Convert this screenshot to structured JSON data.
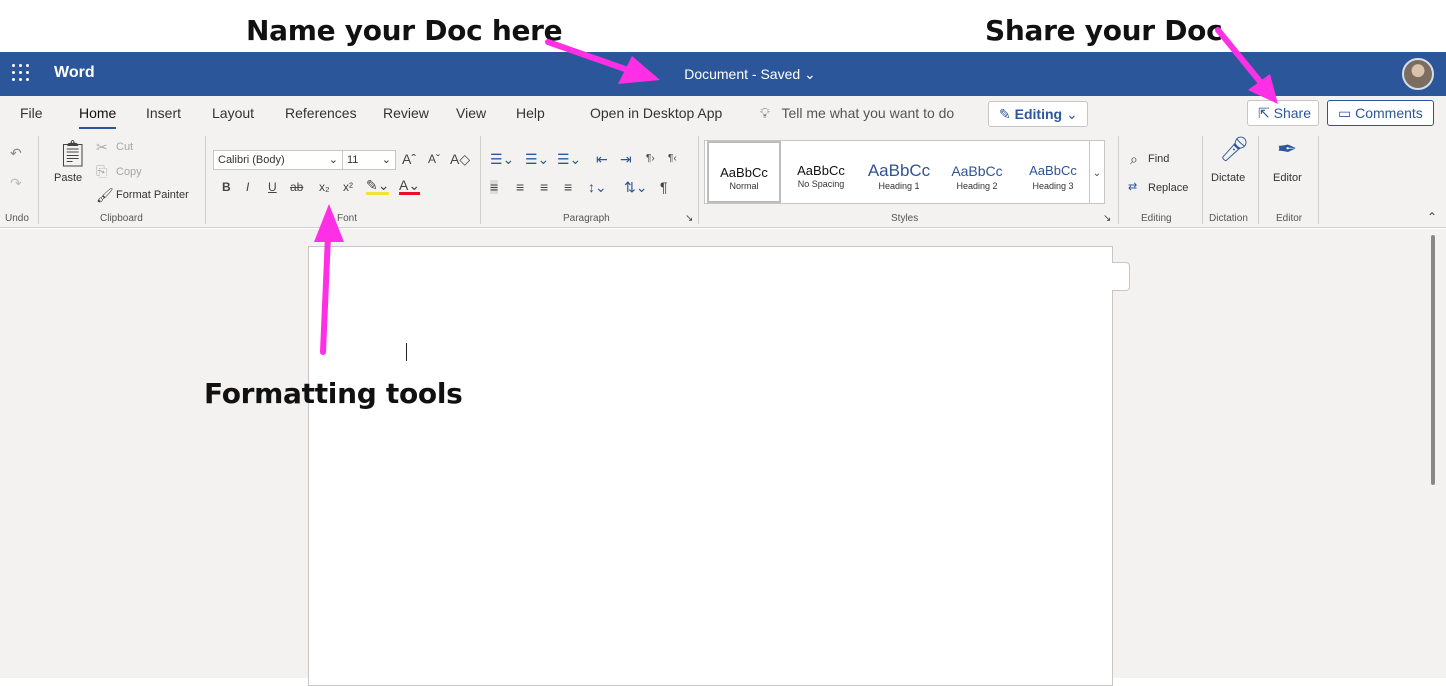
{
  "annotations": {
    "name_doc": "Name your Doc here",
    "share_doc": "Share your Doc",
    "formatting": "Formatting tools"
  },
  "colors": {
    "app_blue": "#2b579a",
    "annotation_arrow": "#ff2fe6"
  },
  "appbar": {
    "app_name": "Word",
    "doc_title": "Document - Saved ⌄"
  },
  "tabs": [
    "File",
    "Home",
    "Insert",
    "Layout",
    "References",
    "Review",
    "View",
    "Help",
    "Open in Desktop App"
  ],
  "active_tab": "Home",
  "tellme": "Tell me what you want to do",
  "editing_mode": "Editing",
  "share_label": "Share",
  "comments_label": "Comments",
  "ribbon": {
    "undo_label": "Undo",
    "clipboard": {
      "paste": "Paste",
      "cut": "Cut",
      "copy": "Copy",
      "format_painter": "Format Painter",
      "label": "Clipboard"
    },
    "font": {
      "name": "Calibri (Body)",
      "size": "11",
      "label": "Font"
    },
    "paragraph_label": "Paragraph",
    "styles": {
      "items": [
        {
          "sample": "AaBbCc",
          "name": "Normal"
        },
        {
          "sample": "AaBbCc",
          "name": "No Spacing"
        },
        {
          "sample": "AaBbCc",
          "name": "Heading 1"
        },
        {
          "sample": "AaBbCc",
          "name": "Heading 2"
        },
        {
          "sample": "AaBbCc",
          "name": "Heading 3"
        }
      ],
      "label": "Styles"
    },
    "editing": {
      "find": "Find",
      "replace": "Replace",
      "label": "Editing"
    },
    "dictation": {
      "button": "Dictate",
      "label": "Dictation"
    },
    "editor": {
      "button": "Editor",
      "label": "Editor"
    }
  }
}
